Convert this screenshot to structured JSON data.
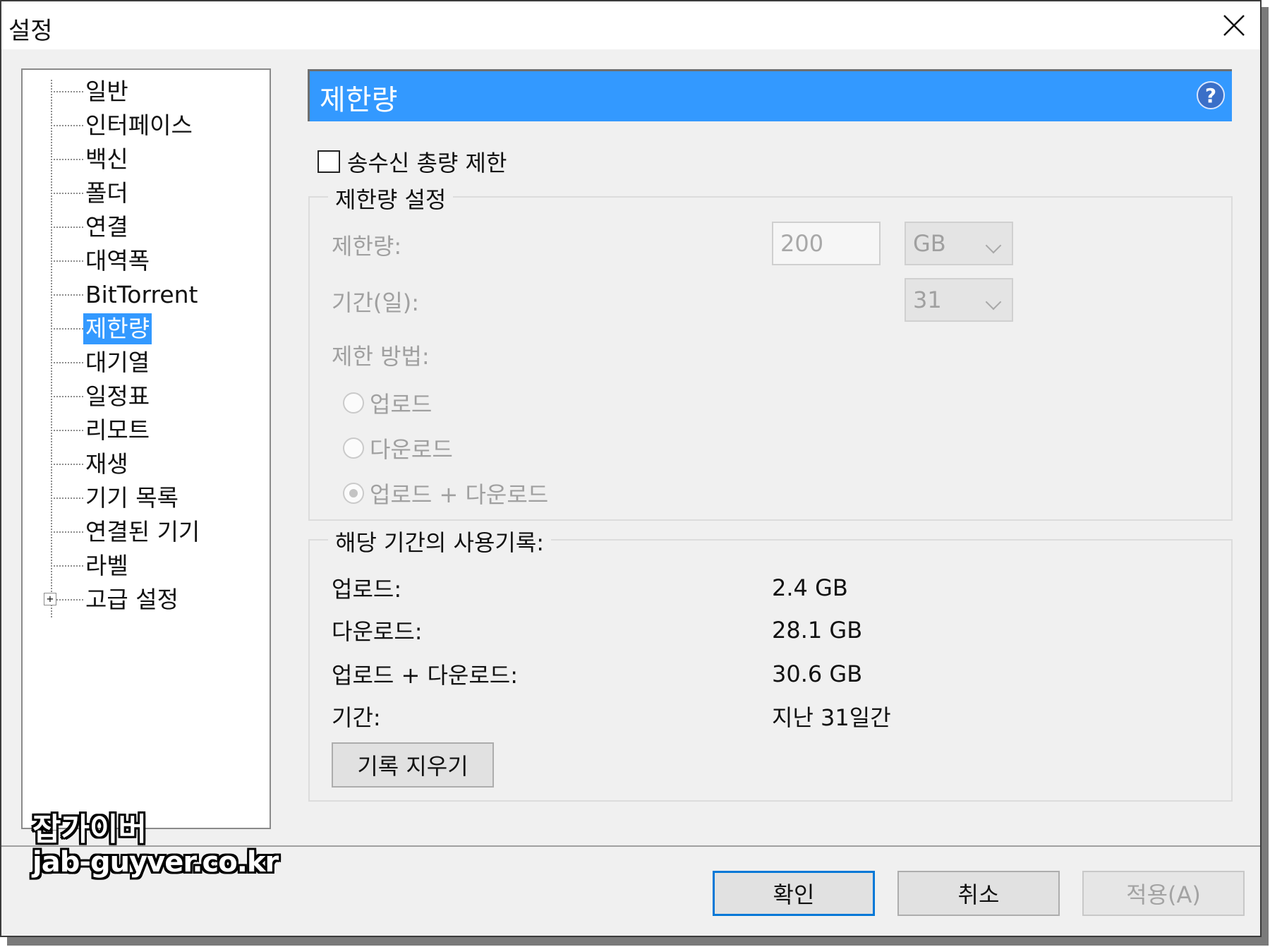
{
  "window": {
    "title": "설정"
  },
  "sidebar": {
    "items": [
      {
        "label": "일반"
      },
      {
        "label": "인터페이스"
      },
      {
        "label": "백신"
      },
      {
        "label": "폴더"
      },
      {
        "label": "연결"
      },
      {
        "label": "대역폭"
      },
      {
        "label": "BitTorrent"
      },
      {
        "label": "제한량",
        "selected": true
      },
      {
        "label": "대기열"
      },
      {
        "label": "일정표"
      },
      {
        "label": "리모트"
      },
      {
        "label": "재생"
      },
      {
        "label": "기기 목록"
      },
      {
        "label": "연결된 기기"
      },
      {
        "label": "라벨"
      },
      {
        "label": "고급 설정",
        "expandable": true
      }
    ],
    "expander_glyph": "+"
  },
  "watermark": {
    "name": "잡가이버",
    "url": "jab-guyver.co.kr"
  },
  "panel": {
    "title": "제한량",
    "help_glyph": "?",
    "enable_checkbox": {
      "label": "송수신 총량 제한",
      "checked": false
    },
    "limit_group": {
      "legend": "제한량 설정",
      "limit_label": "제한량:",
      "limit_value": "200",
      "unit": "GB",
      "period_label": "기간(일):",
      "period_value": "31",
      "method_label": "제한 방법:",
      "radios": [
        {
          "label": "업로드",
          "selected": false
        },
        {
          "label": "다운로드",
          "selected": false
        },
        {
          "label": "업로드 + 다운로드",
          "selected": true
        }
      ]
    },
    "usage_group": {
      "legend": "해당 기간의 사용기록:",
      "rows": [
        {
          "label": "업로드:",
          "value": "2.4 GB"
        },
        {
          "label": "다운로드:",
          "value": "28.1 GB"
        },
        {
          "label": "업로드 + 다운로드:",
          "value": "30.6 GB"
        },
        {
          "label": "기간:",
          "value": "지난 31일간"
        }
      ],
      "clear_button": "기록 지우기"
    }
  },
  "buttons": {
    "ok": "확인",
    "cancel": "취소",
    "apply": "적용(A)"
  },
  "colors": {
    "accent": "#3399ff",
    "window_bg": "#f0f0f0",
    "disabled_text": "#a0a0a0"
  }
}
